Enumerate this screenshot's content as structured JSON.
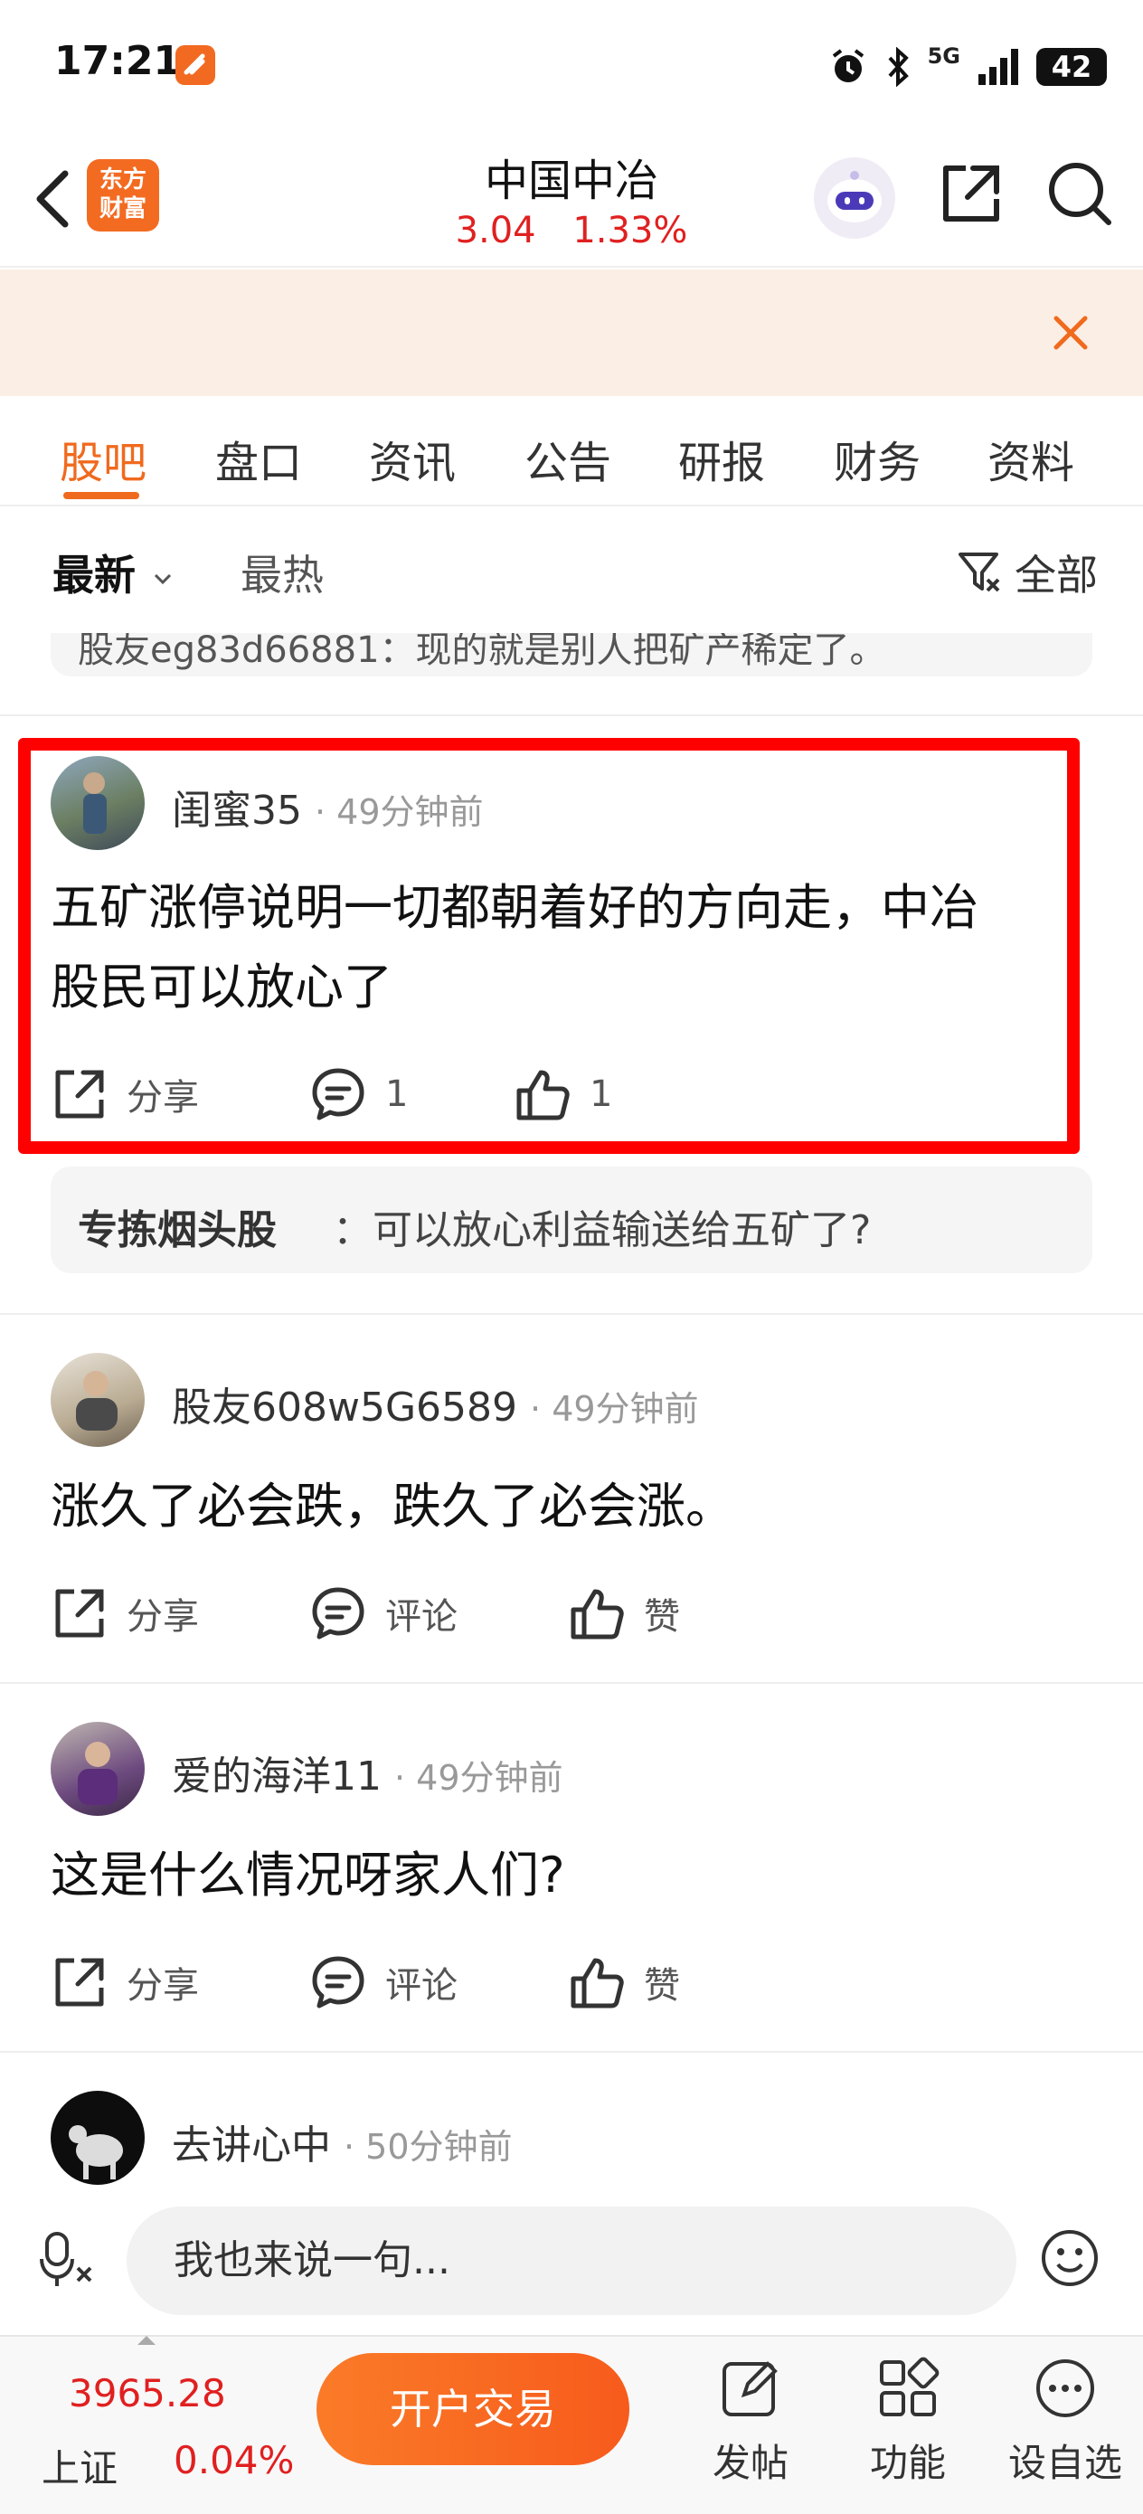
{
  "status_bar": {
    "time": "17:21",
    "network": "5G",
    "battery": "42"
  },
  "header": {
    "logo_lines": [
      "东方",
      "财富"
    ],
    "stock_name": "中国中冶",
    "price": "3.04",
    "change_pct": "1.33%"
  },
  "tabs": [
    "股吧",
    "盘口",
    "资讯",
    "公告",
    "研报",
    "财务",
    "资料"
  ],
  "active_tab": "股吧",
  "filter": {
    "latest": "最新",
    "hot": "最热",
    "all": "全部"
  },
  "partial_reply_text": "股友eg83d66881：现的就是别人把矿产稀定了。",
  "actions": {
    "share": "分享",
    "comment": "评论",
    "like": "赞"
  },
  "posts": [
    {
      "username": "闺蜜35",
      "time": "· 49分钟前",
      "text_lines": [
        "五矿涨停说明一切都朝着好的方向走，中冶",
        "股民可以放心了"
      ],
      "comment_count": "1",
      "like_count": "1",
      "reply": {
        "name": "专拣烟头股",
        "text": "：可以放心利益输送给五矿了?"
      }
    },
    {
      "username": "股友608w5G6589",
      "time": "· 49分钟前",
      "text_lines": [
        "涨久了必会跌，跌久了必会涨。"
      ]
    },
    {
      "username": "爱的海洋11",
      "time": "· 49分钟前",
      "text_lines": [
        "这是什么情况呀家人们?"
      ]
    },
    {
      "username": "去讲心中",
      "time": "· 50分钟前"
    }
  ],
  "comment_bar": {
    "placeholder": "我也来说一句..."
  },
  "bottom_nav": {
    "index_value": "3965.28",
    "index_name": "上证",
    "index_pct": "0.04%",
    "open_button": "开户交易",
    "items": [
      "发帖",
      "功能",
      "设自选"
    ]
  },
  "colors": {
    "accent": "#f06a1e",
    "up_red": "#e02020",
    "highlight": "#ff0000"
  }
}
